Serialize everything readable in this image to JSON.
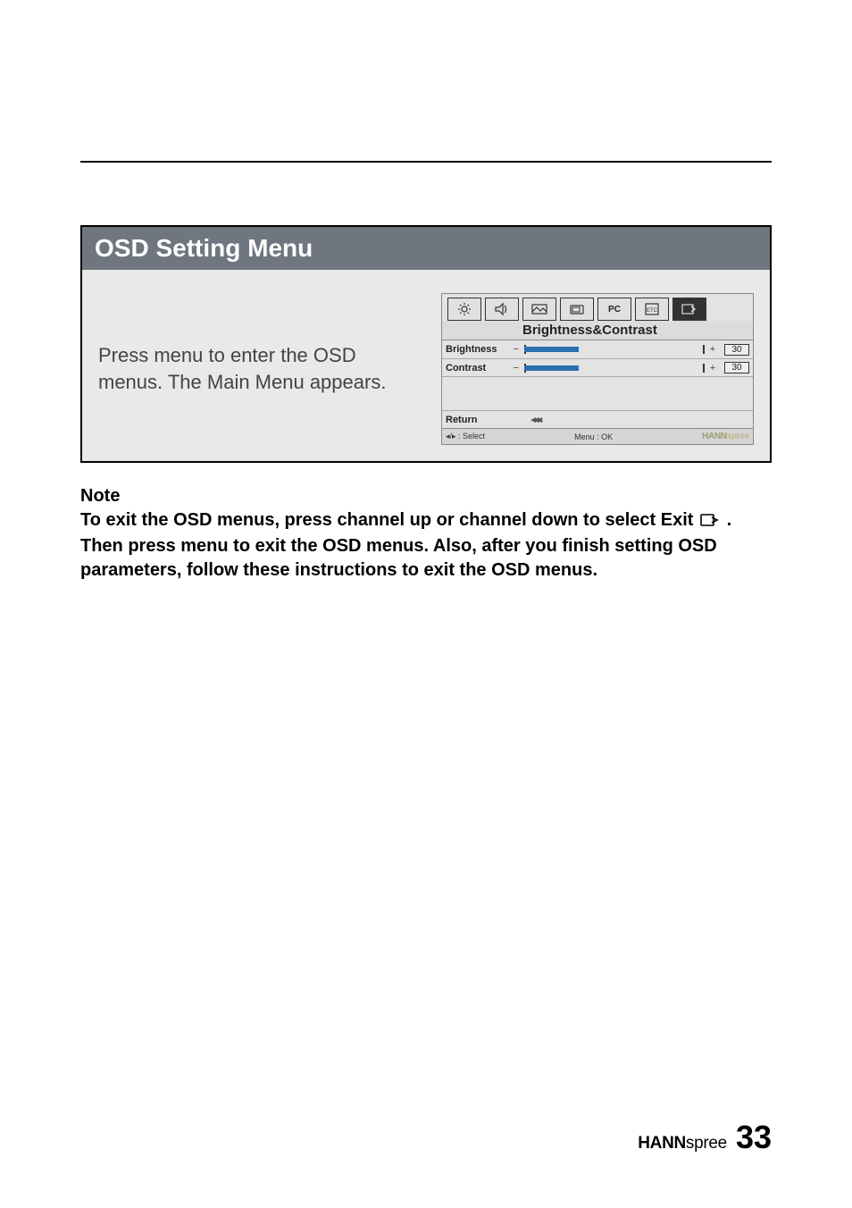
{
  "panel_title": "OSD Setting Menu",
  "panel_body_text": "Press menu to enter the OSD menus. The Main Menu appears.",
  "osd": {
    "subtitle": "Brightness&Contrast",
    "tabs": {
      "pc_label": "PC"
    },
    "rows": {
      "brightness": {
        "label": "Brightness",
        "value": "30"
      },
      "contrast": {
        "label": "Contrast",
        "value": "30"
      }
    },
    "return_label": "Return",
    "return_arrows": "◂◂◂",
    "footer": {
      "select": "◂/▸ : Select",
      "menu_ok": "Menu  :  OK",
      "brand_bold": "HANN",
      "brand_rest": "spree"
    }
  },
  "signs": {
    "minus": "−",
    "plus": "+"
  },
  "note": {
    "heading": "Note",
    "line1": "To exit the OSD menus, press channel up or channel down to select Exit ",
    "line2_after_icon": ". Then press menu to exit the OSD menus. Also, after you finish setting OSD parameters, follow these instructions to exit the OSD menus."
  },
  "footer_brand_bold": "HANN",
  "footer_brand_rest": "spree",
  "page_number": "33"
}
